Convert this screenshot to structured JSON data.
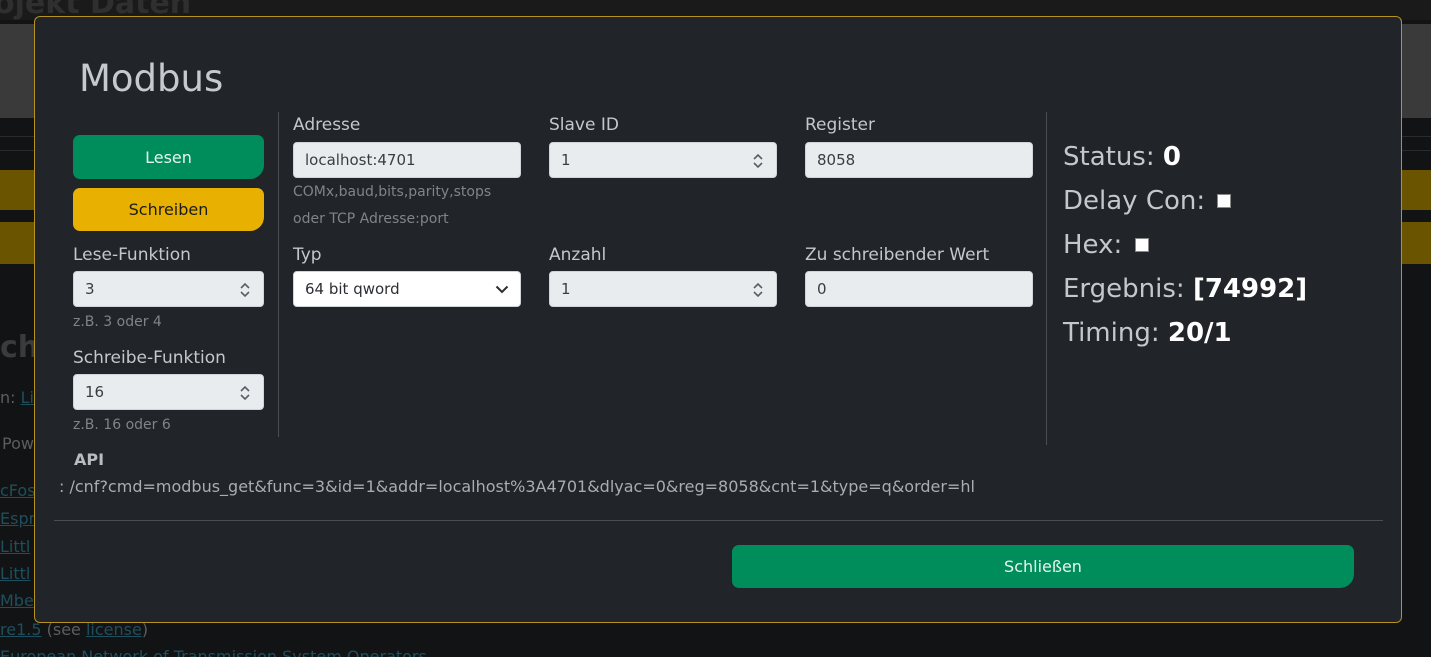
{
  "background": {
    "header_title": "ojekt Daten",
    "partial_heading": "ch",
    "link_row_prefix": "n:",
    "link_row_link": "Li",
    "pow_text": "Pow",
    "links": [
      "cFos",
      "Espr",
      "Littl",
      "Littl",
      "Mbe"
    ],
    "license_prefix": "re1.5",
    "license_mid": "(see",
    "license_link": "license",
    "license_suffix": ")",
    "footer_text": "European Network of Transmission System Operators"
  },
  "modal": {
    "title": "Modbus",
    "buttons": {
      "read": "Lesen",
      "write": "Schreiben",
      "close": "Schließen"
    },
    "left": {
      "read_function_label": "Lese-Funktion",
      "read_function_value": "3",
      "read_function_hint": "z.B. 3 oder 4",
      "write_function_label": "Schreibe-Funktion",
      "write_function_value": "16",
      "write_function_hint": "z.B. 16 oder 6"
    },
    "form": {
      "address_label": "Adresse",
      "address_value": "localhost:4701",
      "address_hint_1": "COMx,baud,bits,parity,stops",
      "address_hint_2": "oder TCP Adresse:port",
      "slave_id_label": "Slave ID",
      "slave_id_value": "1",
      "register_label": "Register",
      "register_value": "8058",
      "type_label": "Typ",
      "type_value": "64 bit qword",
      "count_label": "Anzahl",
      "count_value": "1",
      "write_value_label": "Zu schreibender Wert",
      "write_value_value": "0"
    },
    "status": {
      "status_label": "Status:",
      "status_value": "0",
      "delay_label": "Delay Con:",
      "hex_label": "Hex:",
      "result_label": "Ergebnis:",
      "result_value": "[74992]",
      "timing_label": "Timing:",
      "timing_value": "20/1"
    },
    "api": {
      "title": "API",
      "url": ": /cnf?cmd=modbus_get&func=3&id=1&addr=localhost%3A4701&dlyac=0&reg=8058&cnt=1&type=q&order=hl"
    }
  },
  "colors": {
    "accent_green": "#008d5c",
    "accent_yellow": "#e8b000",
    "modal_border": "#b69220",
    "modal_bg": "#212429"
  }
}
